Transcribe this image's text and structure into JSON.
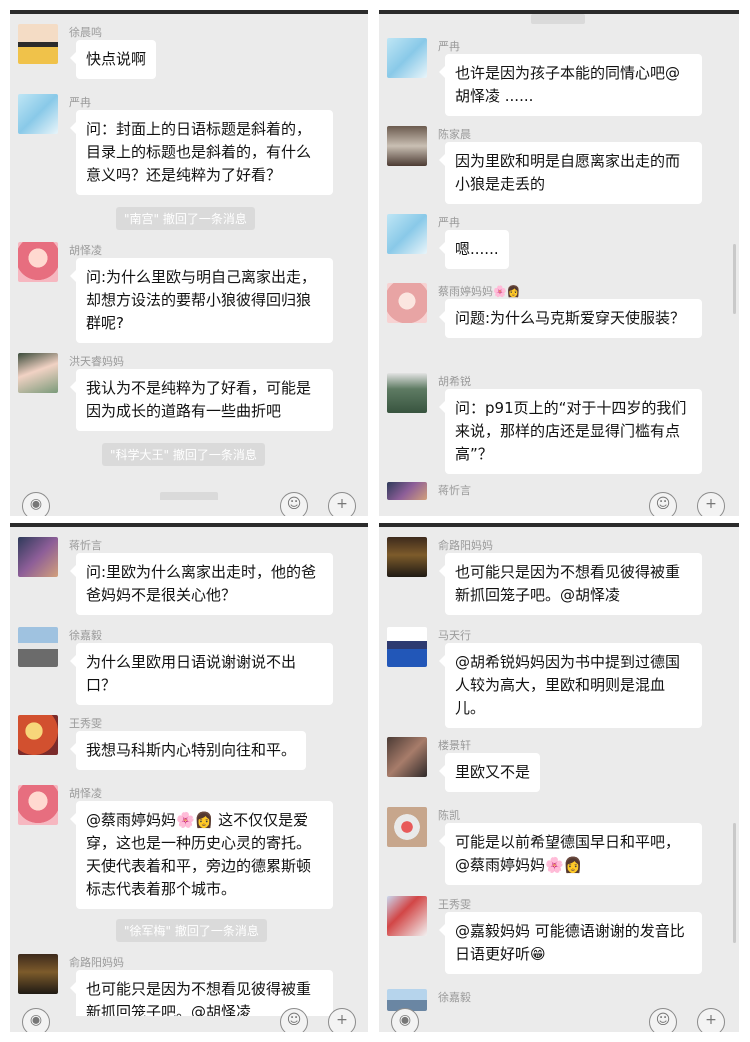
{
  "panels": [
    {
      "messages": [
        {
          "name": "徐晨鸣",
          "text": "快点说啊"
        },
        {
          "name": "严冉",
          "text": "问：封面上的日语标题是斜着的，目录上的标题也是斜着的，有什么意义吗？还是纯粹为了好看？"
        },
        {
          "system": "\"南宫\" 撤回了一条消息"
        },
        {
          "name": "胡怿凌",
          "text": "问:为什么里欧与明自己离家出走，却想方设法的要帮小狼彼得回归狼群呢?"
        },
        {
          "name": "洪天睿妈妈",
          "text": "我认为不是纯粹为了好看，可能是因为成长的道路有一些曲折吧"
        },
        {
          "system": "\"科学大王\" 撤回了一条消息"
        }
      ]
    },
    {
      "messages": [
        {
          "name": "严冉",
          "text": "也许是因为孩子本能的同情心吧@胡怿凌 ......"
        },
        {
          "name": "陈家晨",
          "text": "因为里欧和明是自愿离家出走的而小狼是走丢的"
        },
        {
          "name": "严冉",
          "text": "嗯......"
        },
        {
          "name": "蔡雨婷妈妈🌸👩",
          "text": "问题:为什么马克斯爱穿天使服装？"
        },
        {
          "name": "胡希锐",
          "text": "问：p91页上的“对于十四岁的我们来说，那样的店还是显得门槛有点高”？"
        },
        {
          "name": "蒋忻言"
        }
      ]
    },
    {
      "messages": [
        {
          "name": "蒋忻言",
          "text": "问:里欧为什么离家出走时，他的爸爸妈妈不是很关心他？"
        },
        {
          "name": "徐嘉毅",
          "text": "为什么里欧用日语说谢谢说不出口？"
        },
        {
          "name": "王秀雯",
          "text": "我想马科斯内心特别向往和平。"
        },
        {
          "name": "胡怿凌",
          "text": "@蔡雨婷妈妈🌸👩 这不仅仅是爱穿，这也是一种历史心灵的寄托。天使代表着和平，旁边的德累斯顿标志代表着那个城市。"
        },
        {
          "system": "\"徐军梅\" 撤回了一条消息"
        },
        {
          "name": "俞路阳妈妈",
          "text": "也可能只是因为不想看见彼得被重新抓回笼子吧。@胡怿凌"
        }
      ]
    },
    {
      "messages": [
        {
          "name": "俞路阳妈妈",
          "text": "也可能只是因为不想看见彼得被重新抓回笼子吧。@胡怿凌"
        },
        {
          "name": "马天行",
          "text": "@胡希锐妈妈因为书中提到过德国人较为高大，里欧和明则是混血儿。"
        },
        {
          "name": "楼景轩",
          "text": "里欧又不是"
        },
        {
          "name": "陈凯",
          "text": "可能是以前希望德国早日和平吧，@蔡雨婷妈妈🌸👩"
        },
        {
          "name": "王秀雯",
          "text": "@嘉毅妈妈 可能德语谢谢的发音比日语更好听😁"
        },
        {
          "name": "徐嘉毅"
        }
      ]
    }
  ],
  "icons": {
    "voice": "voice-icon",
    "emoji": "emoji-icon",
    "plus": "plus-icon"
  }
}
